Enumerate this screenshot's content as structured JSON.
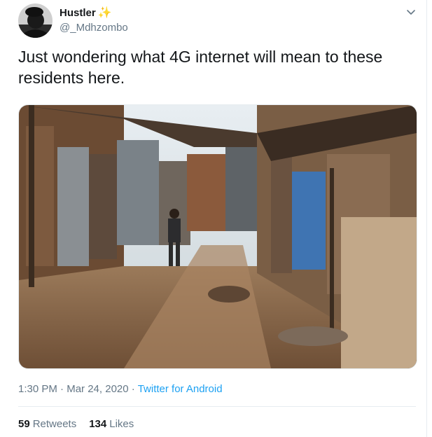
{
  "tweet": {
    "display_name": "Hustler",
    "name_emoji": "✨",
    "handle": "@_Mdhzombo",
    "text": "Just wondering what 4G internet will mean to these\nresidents here.",
    "time": "1:30 PM",
    "date": "Mar 24, 2020",
    "separator": "·",
    "source": "Twitter for Android",
    "retweets_count": "59",
    "retweets_label": "Retweets",
    "likes_count": "134",
    "likes_label": "Likes"
  },
  "icons": {
    "avatar": "avatar",
    "more": "chevron-down-icon"
  },
  "colors": {
    "text": "#14171a",
    "secondary": "#657786",
    "link": "#1da1f2",
    "divider": "#e6ecf0"
  }
}
